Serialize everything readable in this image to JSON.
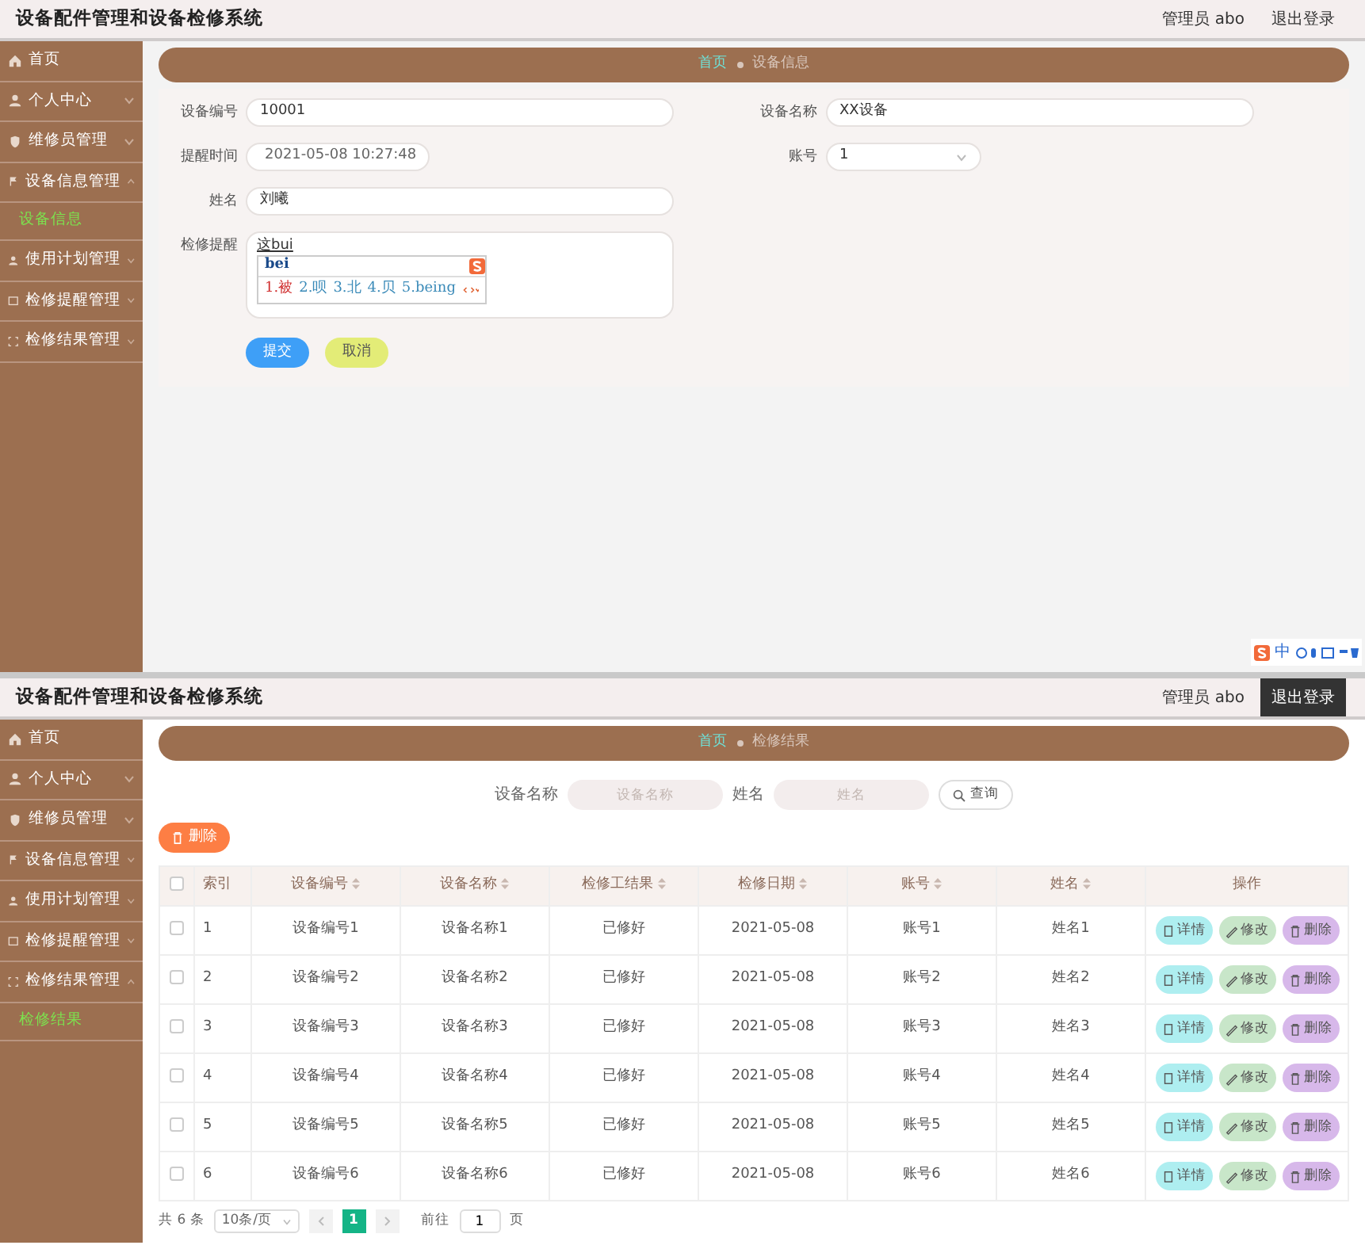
{
  "screens": [
    {
      "kind": "form",
      "app_title": "设备配件管理和设备检修系统",
      "user": "管理员 abo",
      "logout": {
        "label": "退出登录",
        "hovered": false
      },
      "sidebar": [
        {
          "label": "首页",
          "kind": "link"
        },
        {
          "label": "个人中心",
          "kind": "menu",
          "expanded": false
        },
        {
          "label": "维修员管理",
          "kind": "menu",
          "expanded": false
        },
        {
          "label": "设备信息管理",
          "kind": "menu",
          "expanded": true,
          "children": [
            {
              "label": "设备信息",
              "selected": true
            }
          ]
        },
        {
          "label": "使用计划管理",
          "kind": "menu",
          "expanded": false
        },
        {
          "label": "检修提醒管理",
          "kind": "menu",
          "expanded": false
        },
        {
          "label": "检修结果管理",
          "kind": "menu",
          "expanded": false
        }
      ],
      "breadcrumb": [
        {
          "label": "首页",
          "current": false
        },
        {
          "label": "设备信息",
          "current": true
        }
      ],
      "form": {
        "left": [
          {
            "label": "设备编号",
            "kind": "text",
            "value": "10001"
          },
          {
            "label": "提醒时间",
            "kind": "datetime",
            "value": "2021-05-08 10:27:48"
          },
          {
            "label": "姓名",
            "kind": "text",
            "value": "刘曦"
          },
          {
            "label": "检修提醒",
            "kind": "textarea",
            "value": "这bui",
            "ime": {
              "input": "bei",
              "candidates": [
                "1.被",
                "2.呗",
                "3.北",
                "4.贝",
                "5.being"
              ]
            }
          }
        ],
        "right": [
          {
            "label": "设备名称",
            "kind": "text",
            "value": "XX设备"
          },
          {
            "label": "账号",
            "kind": "select",
            "value": "1"
          }
        ],
        "buttons": [
          {
            "label": "提交",
            "kind": "primary"
          },
          {
            "label": "取消",
            "kind": "cancel"
          }
        ]
      },
      "ime_bar": {
        "mode": "中"
      }
    },
    {
      "kind": "table",
      "app_title": "设备配件管理和设备检修系统",
      "user": "管理员 abo",
      "logout": {
        "label": "退出登录",
        "hovered": true
      },
      "sidebar": [
        {
          "label": "首页",
          "kind": "link"
        },
        {
          "label": "个人中心",
          "kind": "menu",
          "expanded": false
        },
        {
          "label": "维修员管理",
          "kind": "menu",
          "expanded": false
        },
        {
          "label": "设备信息管理",
          "kind": "menu",
          "expanded": false
        },
        {
          "label": "使用计划管理",
          "kind": "menu",
          "expanded": false
        },
        {
          "label": "检修提醒管理",
          "kind": "menu",
          "expanded": false
        },
        {
          "label": "检修结果管理",
          "kind": "menu",
          "expanded": true,
          "children": [
            {
              "label": "检修结果",
              "selected": true
            }
          ]
        }
      ],
      "breadcrumb": [
        {
          "label": "首页",
          "current": false
        },
        {
          "label": "检修结果",
          "current": true
        }
      ],
      "search": {
        "fields": [
          {
            "label": "设备名称",
            "placeholder": "设备名称"
          },
          {
            "label": "姓名",
            "placeholder": "姓名"
          }
        ],
        "button": "查询"
      },
      "bulk_delete": "删除",
      "table": {
        "select_all_checked": false,
        "columns": [
          {
            "label": "索引",
            "sortable": false
          },
          {
            "label": "设备编号",
            "sortable": true
          },
          {
            "label": "设备名称",
            "sortable": true
          },
          {
            "label": "检修工结果",
            "sortable": true
          },
          {
            "label": "检修日期",
            "sortable": true
          },
          {
            "label": "账号",
            "sortable": true
          },
          {
            "label": "姓名",
            "sortable": true
          },
          {
            "label": "操作",
            "sortable": false
          }
        ],
        "rows": [
          {
            "checked": false,
            "cells": [
              "1",
              "设备编号1",
              "设备名称1",
              "已修好",
              "2021-05-08",
              "账号1",
              "姓名1"
            ],
            "actions": [
              "详情",
              "修改",
              "删除"
            ]
          },
          {
            "checked": false,
            "cells": [
              "2",
              "设备编号2",
              "设备名称2",
              "已修好",
              "2021-05-08",
              "账号2",
              "姓名2"
            ],
            "actions": [
              "详情",
              "修改",
              "删除"
            ]
          },
          {
            "checked": false,
            "cells": [
              "3",
              "设备编号3",
              "设备名称3",
              "已修好",
              "2021-05-08",
              "账号3",
              "姓名3"
            ],
            "actions": [
              "详情",
              "修改",
              "删除"
            ]
          },
          {
            "checked": false,
            "cells": [
              "4",
              "设备编号4",
              "设备名称4",
              "已修好",
              "2021-05-08",
              "账号4",
              "姓名4"
            ],
            "actions": [
              "详情",
              "修改",
              "删除"
            ]
          },
          {
            "checked": false,
            "cells": [
              "5",
              "设备编号5",
              "设备名称5",
              "已修好",
              "2021-05-08",
              "账号5",
              "姓名5"
            ],
            "actions": [
              "详情",
              "修改",
              "删除"
            ]
          },
          {
            "checked": false,
            "cells": [
              "6",
              "设备编号6",
              "设备名称6",
              "已修好",
              "2021-05-08",
              "账号6",
              "姓名6"
            ],
            "actions": [
              "详情",
              "修改",
              "删除"
            ]
          }
        ]
      },
      "pagination": {
        "total": "共 6 条",
        "page_size": "10条/页",
        "pages": [
          {
            "label": "1",
            "selected": true
          }
        ],
        "goto_label": "前往",
        "goto_value": "1",
        "goto_suffix": "页"
      }
    }
  ]
}
